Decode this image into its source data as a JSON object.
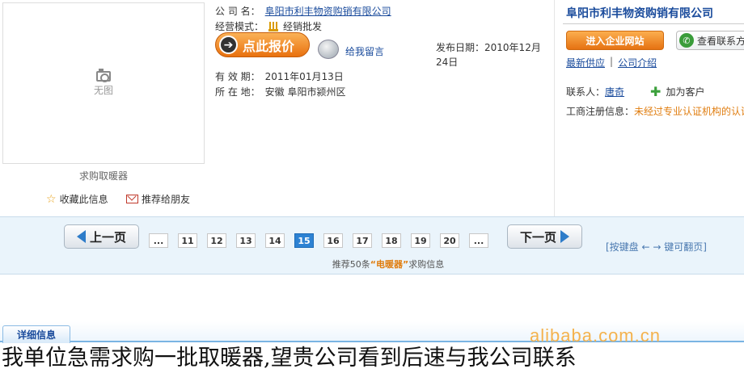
{
  "product": {
    "image_placeholder": "无图",
    "caption": "求购取暖器",
    "collect_label": "收藏此信息",
    "recommend_label": "推荐给朋友"
  },
  "info": {
    "company_label": "公 司 名：",
    "company_name": "阜阳市利丰物资购销有限公司",
    "mode_label": "经营模式：",
    "mode_value": "经销批发",
    "quote_button": "点此报价",
    "message_link": "给我留言",
    "publish_label": "发布日期：",
    "publish_value": "2010年12月24日",
    "validity_label": "有 效 期：",
    "validity_value": "2011年01月13日",
    "location_label": "所 在 地：",
    "location_value": "安徽 阜阳市颍州区"
  },
  "company_panel": {
    "title": "阜阳市利丰物资购销有限公司",
    "enter_site_button": "进入企业网站",
    "contact_button": "查看联系方式",
    "latest_supply_link": "最新供应",
    "separator": "|",
    "intro_link": "公司介绍",
    "contact_label": "联系人：",
    "contact_name": "唐奇",
    "add_customer": "加为客户",
    "reg_label": "工商注册信息：",
    "reg_value": "未经过专业认证机构的认证"
  },
  "pager": {
    "prev_label": "上一页",
    "next_label": "下一页",
    "ellipsis": "...",
    "pages": [
      "11",
      "12",
      "13",
      "14",
      "15",
      "16",
      "17",
      "18",
      "19",
      "20"
    ],
    "current_page": "15",
    "keyboard_hint": "[按键盘 ← → 键可翻页]",
    "recommend_prefix": "推荐50条",
    "recommend_keyword": "“电暖器”",
    "recommend_suffix": "求购信息"
  },
  "detail": {
    "tab_label": "详细信息",
    "watermark": "alibaba.com.cn",
    "body_text": "我单位急需求购一批取暖器,望贵公司看到后速与我公司联系"
  },
  "colors": {
    "link": "#1a4b9c",
    "orange": "#e8710f",
    "active_page": "#2d82d3",
    "pager_bg": "#eaf4fb"
  }
}
